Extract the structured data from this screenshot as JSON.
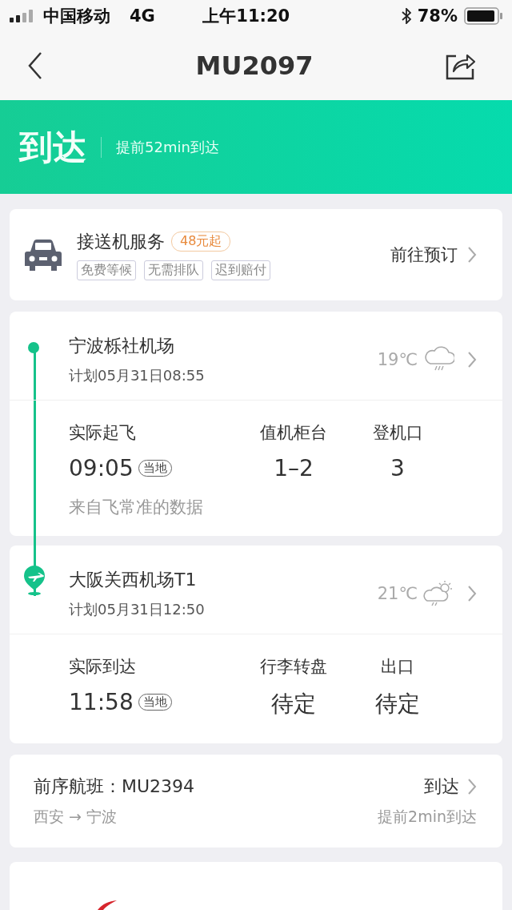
{
  "status_bar": {
    "carrier": "中国移动",
    "network": "4G",
    "time": "上午11:20",
    "battery": "78%"
  },
  "nav": {
    "title": "MU2097"
  },
  "banner": {
    "status": "到达",
    "note": "提前52min到达"
  },
  "transfer": {
    "title": "接送机服务",
    "price": "48元起",
    "tags": [
      "免费等候",
      "无需排队",
      "迟到赔付"
    ],
    "action": "前往预订"
  },
  "legs": [
    {
      "kind": "departure",
      "airport": "宁波栎社机场",
      "planned": "计划05月31日08:55",
      "temp": "19℃",
      "weather": {
        "kind": "rain"
      },
      "stats": [
        {
          "label": "实际起飞",
          "value": "09:05",
          "badge": "当地"
        },
        {
          "label": "值机柜台",
          "value": "1–2"
        },
        {
          "label": "登机口",
          "value": "3"
        }
      ],
      "source": "来自飞常准的数据"
    },
    {
      "kind": "arrival",
      "airport": "大阪关西机场T1",
      "planned": "计划05月31日12:50",
      "temp": "21℃",
      "weather": {
        "kind": "sun-rain"
      },
      "stats": [
        {
          "label": "实际到达",
          "value": "11:58",
          "badge": "当地"
        },
        {
          "label": "行李转盘",
          "value": "待定"
        },
        {
          "label": "出口",
          "value": "待定"
        }
      ]
    }
  ],
  "previous": {
    "label": "前序航班：MU2394",
    "route": "西安 → 宁波",
    "status": "到达",
    "note": "提前2min到达"
  }
}
